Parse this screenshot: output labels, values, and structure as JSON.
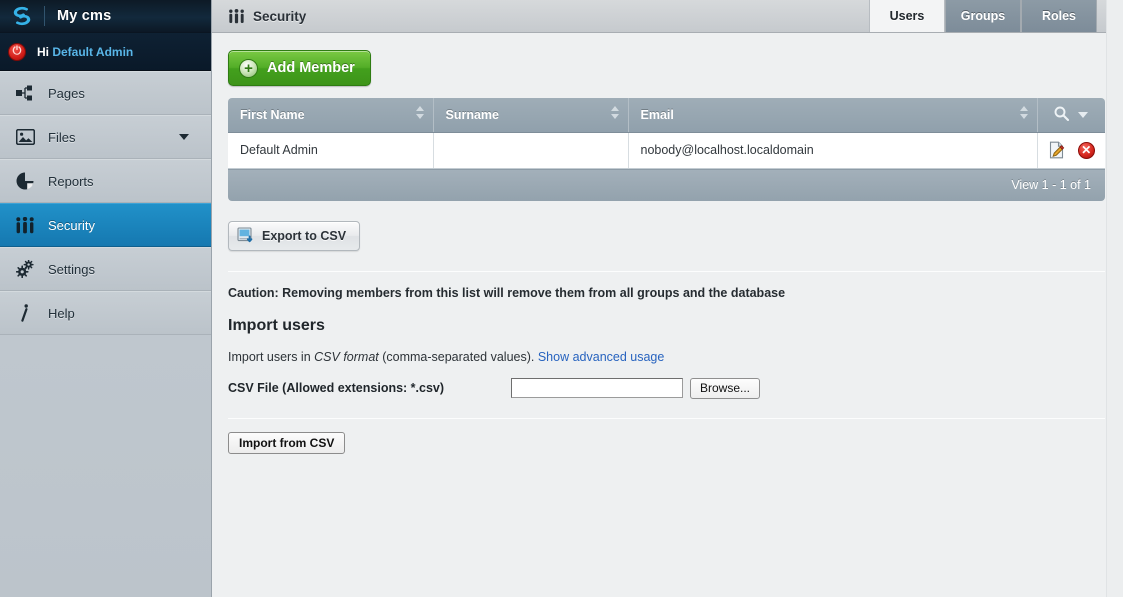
{
  "sidebar": {
    "logo": {
      "mark": "icon-silverstripe-logo",
      "title": "My cms"
    },
    "profile": {
      "power_icon": "power-icon",
      "greeting": "Hi",
      "user": "Default Admin"
    },
    "items": [
      {
        "label": "Pages",
        "icon": "sitetree-icon",
        "active": false,
        "caret": false
      },
      {
        "label": "Files",
        "icon": "image-icon",
        "active": false,
        "caret": true
      },
      {
        "label": "Reports",
        "icon": "pie-chart-icon",
        "active": false,
        "caret": false
      },
      {
        "label": "Security",
        "icon": "people-icon",
        "active": true,
        "caret": false
      },
      {
        "label": "Settings",
        "icon": "gears-icon",
        "active": false,
        "caret": false
      },
      {
        "label": "Help",
        "icon": "info-icon",
        "active": false,
        "caret": false
      }
    ]
  },
  "topbar": {
    "icon": "people-icon",
    "title": "Security",
    "tabs": [
      {
        "label": "Users",
        "active": true
      },
      {
        "label": "Groups",
        "active": false
      },
      {
        "label": "Roles",
        "active": false
      }
    ]
  },
  "actions": {
    "add_member": "Add Member",
    "add_member_icon": "plus-circle-icon",
    "export_csv": "Export to CSV",
    "export_csv_icon": "csv-export-icon"
  },
  "grid": {
    "columns": [
      {
        "label": "First Name",
        "sortable": true
      },
      {
        "label": "Surname",
        "sortable": true
      },
      {
        "label": "Email",
        "sortable": true
      }
    ],
    "actions_header": {
      "search_icon": "search-icon",
      "chevron_icon": "chevron-down-icon"
    },
    "rows": [
      {
        "first_name": "Default Admin",
        "surname": "",
        "email": "nobody@localhost.localdomain",
        "edit_icon": "edit-pencil-icon",
        "delete_icon": "delete-circle-icon"
      }
    ],
    "footer": "View 1 - 1 of 1"
  },
  "notices": {
    "caution": "Caution: Removing members from this list will remove them from all groups and the database"
  },
  "import": {
    "heading": "Import users",
    "desc_prefix": "Import users in ",
    "desc_italic": "CSV format",
    "desc_suffix": " (comma-separated values). ",
    "advanced_link": "Show advanced usage",
    "file_label": "CSV File (Allowed extensions: *.csv)",
    "file_value": "",
    "browse_button": "Browse...",
    "submit_button": "Import from CSV"
  },
  "colors": {
    "accent_blue": "#1f8bc4",
    "link_blue": "#2763bf",
    "sidebar_link": "#59b6e8",
    "add_green": "#53ae28",
    "delete_red": "#d4251c",
    "grid_header": "#97a6b1",
    "grid_footer": "#99a8b3"
  }
}
